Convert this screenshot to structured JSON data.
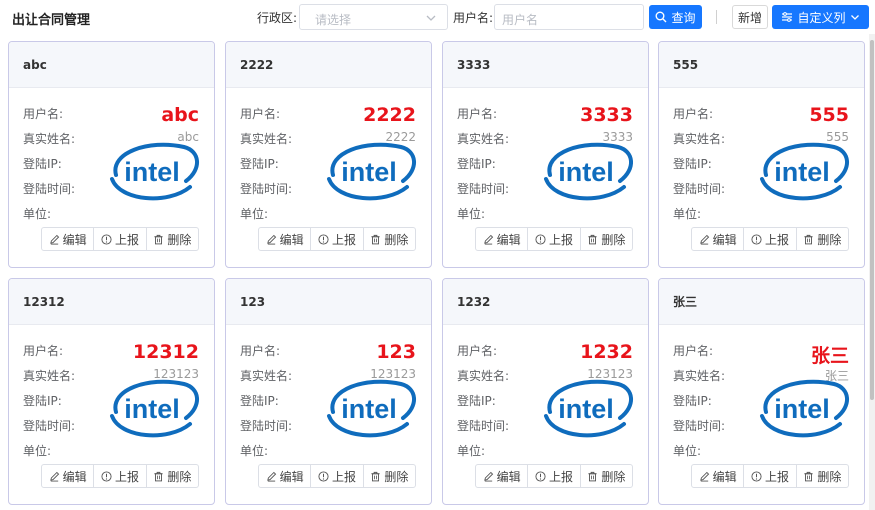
{
  "page": {
    "title": "出让合同管理"
  },
  "filters": {
    "region_label": "行政区:",
    "region_placeholder": "请选择",
    "username_label": "用户名:",
    "username_placeholder": "用户名"
  },
  "toolbar": {
    "query_label": "查询",
    "add_label": "新增",
    "custom_columns_label": "自定义列"
  },
  "card_fields": {
    "username": "用户名:",
    "realname": "真实姓名:",
    "login_ip": "登陆IP:",
    "login_time": "登陆时间:",
    "unit": "单位:"
  },
  "card_actions": {
    "edit": "编辑",
    "report": "上报",
    "delete": "删除"
  },
  "logo_text": "intel",
  "cards": [
    {
      "title": "abc",
      "username": "abc",
      "realname": "abc"
    },
    {
      "title": "2222",
      "username": "2222",
      "realname": "2222"
    },
    {
      "title": "3333",
      "username": "3333",
      "realname": "3333"
    },
    {
      "title": "555",
      "username": "555",
      "realname": "555"
    },
    {
      "title": "12312",
      "username": "12312",
      "realname": "123123"
    },
    {
      "title": "123",
      "username": "123",
      "realname": "123123"
    },
    {
      "title": "1232",
      "username": "1232",
      "realname": "123123"
    },
    {
      "title": "张三",
      "username": "张三",
      "realname": "张三"
    }
  ],
  "colors": {
    "primary": "#1677ff",
    "name_red": "#e8141b",
    "intel_blue": "#0f6cbd",
    "card_border": "#c9c9e8"
  }
}
